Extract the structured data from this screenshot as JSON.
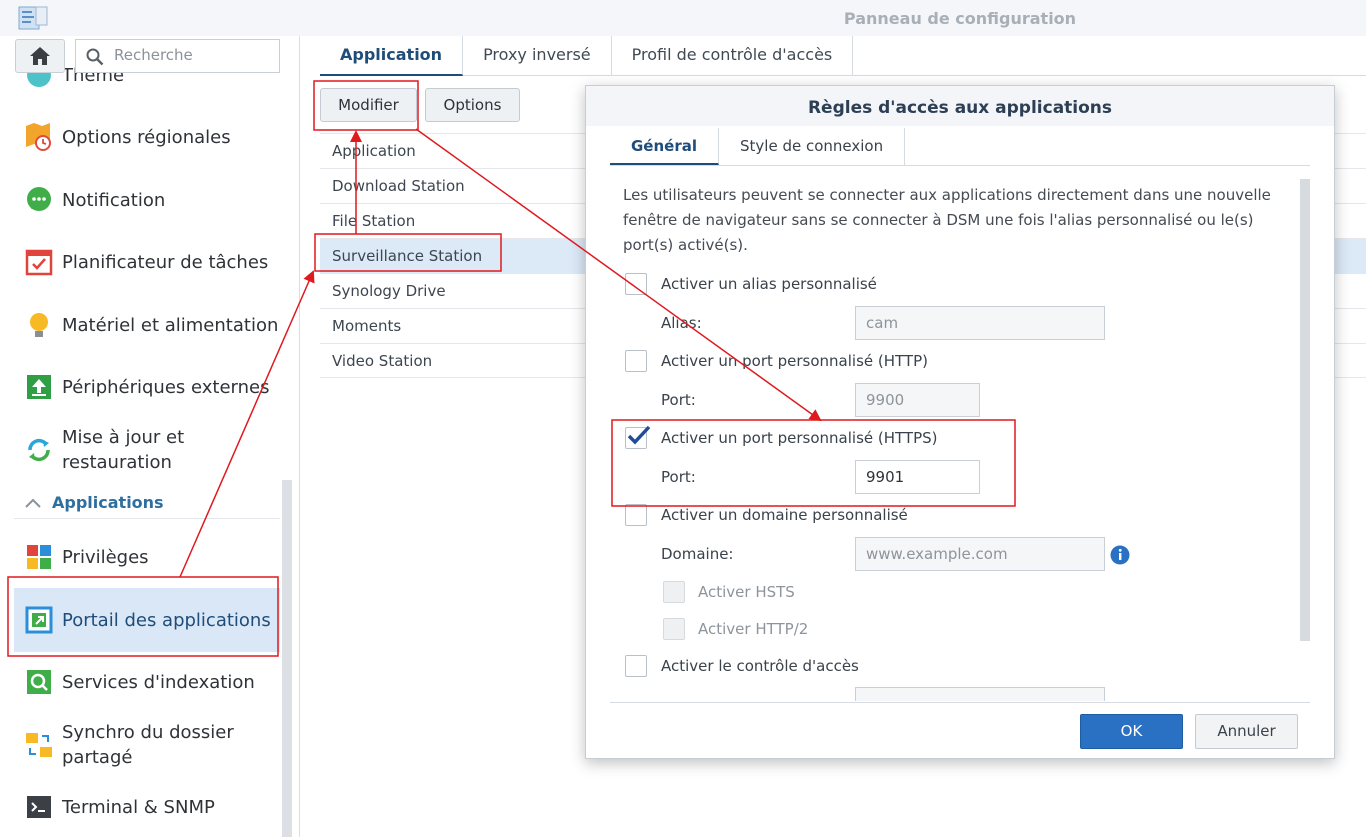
{
  "window": {
    "title": "Panneau de configuration"
  },
  "sidebar": {
    "search_placeholder": "Recherche",
    "top_partial_label": "Thème",
    "items": [
      {
        "label": "Options régionales",
        "icon": "regional-options-icon"
      },
      {
        "label": "Notification",
        "icon": "notification-icon"
      },
      {
        "label": "Planificateur de tâches",
        "icon": "task-scheduler-icon"
      },
      {
        "label": "Matériel et alimentation",
        "icon": "hardware-power-icon"
      },
      {
        "label": "Périphériques externes",
        "icon": "external-devices-icon"
      },
      {
        "label": "Mise à jour et restauration",
        "icon": "update-restore-icon"
      }
    ],
    "section_label": "Applications",
    "app_items": [
      {
        "label": "Privilèges",
        "icon": "privileges-icon"
      },
      {
        "label": "Portail des applications",
        "icon": "application-portal-icon",
        "active": true
      },
      {
        "label": "Services d'indexation",
        "icon": "indexing-service-icon"
      },
      {
        "label": "Synchro du dossier partagé",
        "icon": "shared-folder-sync-icon"
      },
      {
        "label": "Terminal & SNMP",
        "icon": "terminal-snmp-icon"
      }
    ]
  },
  "main": {
    "tabs": [
      "Application",
      "Proxy inversé",
      "Profil de contrôle d'accès"
    ],
    "buttons": {
      "modify": "Modifier",
      "options": "Options"
    },
    "list": [
      "Application",
      "Download Station",
      "File Station",
      "Surveillance Station",
      "Synology Drive",
      "Moments",
      "Video Station"
    ],
    "selected_row": "Surveillance Station"
  },
  "dialog": {
    "title": "Règles d'accès aux applications",
    "tabs": [
      "Général",
      "Style de connexion"
    ],
    "description": "Les utilisateurs peuvent se connecter aux applications directement dans une nouvelle fenêtre de navigateur sans se connecter à DSM une fois l'alias personnalisé ou le(s) port(s) activé(s).",
    "alias_option": "Activer un alias personnalisé",
    "alias_label": "Alias:",
    "alias_value": "cam",
    "http_option": "Activer un port personnalisé (HTTP)",
    "http_port_label": "Port:",
    "http_port_value": "9900",
    "https_option": "Activer un port personnalisé (HTTPS)",
    "https_port_label": "Port:",
    "https_port_value": "9901",
    "domain_option": "Activer un domaine personnalisé",
    "domain_label": "Domaine:",
    "domain_placeholder": "www.example.com",
    "hsts_option": "Activer HSTS",
    "http2_option": "Activer HTTP/2",
    "access_option": "Activer le contrôle d'accès",
    "ok": "OK",
    "cancel": "Annuler"
  },
  "colors": {
    "accent": "#2a71c3",
    "annotation": "#e0191f",
    "selected_row": "#dce9f7"
  }
}
